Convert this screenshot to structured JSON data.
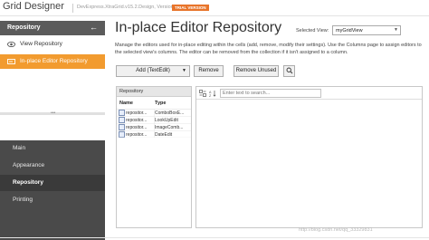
{
  "window": {
    "title": "Grid Designer",
    "subtitle": "DevExpress.XtraGrid.v15.2.Design, Version=15.2.4.0",
    "badge": "TRIAL VERSION"
  },
  "sidebar": {
    "header": "Repository",
    "back_icon": "←",
    "items": [
      {
        "label": "View Repository",
        "icon": "eye-icon"
      },
      {
        "label": "In-place Editor Repository",
        "icon": "editor-icon"
      }
    ],
    "nav": [
      {
        "label": "Main"
      },
      {
        "label": "Appearance"
      },
      {
        "label": "Repository"
      },
      {
        "label": "Printing"
      }
    ],
    "selected_nav_color": "#3a3a3a",
    "active_item_color": "#f29b2f"
  },
  "main": {
    "title": "In-place Editor Repository",
    "selected_view_label": "Selected View:",
    "selected_view_value": "myGridView",
    "description": "Manage the editors used for in-place editing within the cells (add, remove, modify their settings). Use the Columns page to assign editors to the selected view's columns. The editor can be removed from the collection if it isn't assigned to a column.",
    "toolbar": {
      "add_label": "Add (TextEdit)",
      "remove_label": "Remove",
      "remove_unused_label": "Remove Unused"
    },
    "repository": {
      "caption": "Repository",
      "columns": [
        "Name",
        "Type"
      ],
      "rows": [
        {
          "name": "repositor...",
          "type": "ComboBoxE..."
        },
        {
          "name": "repositor...",
          "type": "LookUpEdit"
        },
        {
          "name": "repositor...",
          "type": "ImageComb..."
        },
        {
          "name": "repositor...",
          "type": "DateEdit"
        }
      ]
    },
    "properties": {
      "search_placeholder": "Enter text to search..."
    }
  },
  "watermark": "http://blog.csdn.net/qq_33329831"
}
